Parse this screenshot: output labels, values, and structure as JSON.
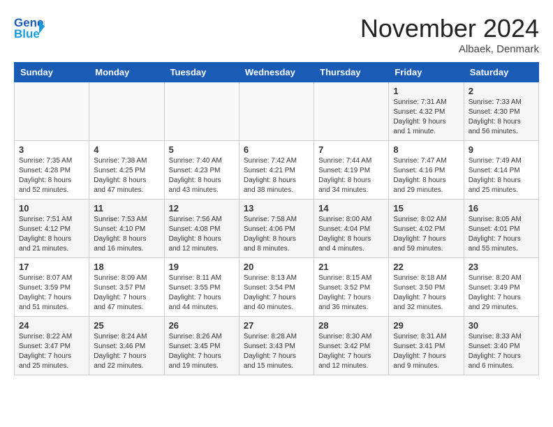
{
  "header": {
    "logo_general": "General",
    "logo_blue": "Blue",
    "month_title": "November 2024",
    "subtitle": "Albaek, Denmark"
  },
  "weekdays": [
    "Sunday",
    "Monday",
    "Tuesday",
    "Wednesday",
    "Thursday",
    "Friday",
    "Saturday"
  ],
  "weeks": [
    [
      {
        "day": "",
        "info": ""
      },
      {
        "day": "",
        "info": ""
      },
      {
        "day": "",
        "info": ""
      },
      {
        "day": "",
        "info": ""
      },
      {
        "day": "",
        "info": ""
      },
      {
        "day": "1",
        "info": "Sunrise: 7:31 AM\nSunset: 4:32 PM\nDaylight: 9 hours\nand 1 minute."
      },
      {
        "day": "2",
        "info": "Sunrise: 7:33 AM\nSunset: 4:30 PM\nDaylight: 8 hours\nand 56 minutes."
      }
    ],
    [
      {
        "day": "3",
        "info": "Sunrise: 7:35 AM\nSunset: 4:28 PM\nDaylight: 8 hours\nand 52 minutes."
      },
      {
        "day": "4",
        "info": "Sunrise: 7:38 AM\nSunset: 4:25 PM\nDaylight: 8 hours\nand 47 minutes."
      },
      {
        "day": "5",
        "info": "Sunrise: 7:40 AM\nSunset: 4:23 PM\nDaylight: 8 hours\nand 43 minutes."
      },
      {
        "day": "6",
        "info": "Sunrise: 7:42 AM\nSunset: 4:21 PM\nDaylight: 8 hours\nand 38 minutes."
      },
      {
        "day": "7",
        "info": "Sunrise: 7:44 AM\nSunset: 4:19 PM\nDaylight: 8 hours\nand 34 minutes."
      },
      {
        "day": "8",
        "info": "Sunrise: 7:47 AM\nSunset: 4:16 PM\nDaylight: 8 hours\nand 29 minutes."
      },
      {
        "day": "9",
        "info": "Sunrise: 7:49 AM\nSunset: 4:14 PM\nDaylight: 8 hours\nand 25 minutes."
      }
    ],
    [
      {
        "day": "10",
        "info": "Sunrise: 7:51 AM\nSunset: 4:12 PM\nDaylight: 8 hours\nand 21 minutes."
      },
      {
        "day": "11",
        "info": "Sunrise: 7:53 AM\nSunset: 4:10 PM\nDaylight: 8 hours\nand 16 minutes."
      },
      {
        "day": "12",
        "info": "Sunrise: 7:56 AM\nSunset: 4:08 PM\nDaylight: 8 hours\nand 12 minutes."
      },
      {
        "day": "13",
        "info": "Sunrise: 7:58 AM\nSunset: 4:06 PM\nDaylight: 8 hours\nand 8 minutes."
      },
      {
        "day": "14",
        "info": "Sunrise: 8:00 AM\nSunset: 4:04 PM\nDaylight: 8 hours\nand 4 minutes."
      },
      {
        "day": "15",
        "info": "Sunrise: 8:02 AM\nSunset: 4:02 PM\nDaylight: 7 hours\nand 59 minutes."
      },
      {
        "day": "16",
        "info": "Sunrise: 8:05 AM\nSunset: 4:01 PM\nDaylight: 7 hours\nand 55 minutes."
      }
    ],
    [
      {
        "day": "17",
        "info": "Sunrise: 8:07 AM\nSunset: 3:59 PM\nDaylight: 7 hours\nand 51 minutes."
      },
      {
        "day": "18",
        "info": "Sunrise: 8:09 AM\nSunset: 3:57 PM\nDaylight: 7 hours\nand 47 minutes."
      },
      {
        "day": "19",
        "info": "Sunrise: 8:11 AM\nSunset: 3:55 PM\nDaylight: 7 hours\nand 44 minutes."
      },
      {
        "day": "20",
        "info": "Sunrise: 8:13 AM\nSunset: 3:54 PM\nDaylight: 7 hours\nand 40 minutes."
      },
      {
        "day": "21",
        "info": "Sunrise: 8:15 AM\nSunset: 3:52 PM\nDaylight: 7 hours\nand 36 minutes."
      },
      {
        "day": "22",
        "info": "Sunrise: 8:18 AM\nSunset: 3:50 PM\nDaylight: 7 hours\nand 32 minutes."
      },
      {
        "day": "23",
        "info": "Sunrise: 8:20 AM\nSunset: 3:49 PM\nDaylight: 7 hours\nand 29 minutes."
      }
    ],
    [
      {
        "day": "24",
        "info": "Sunrise: 8:22 AM\nSunset: 3:47 PM\nDaylight: 7 hours\nand 25 minutes."
      },
      {
        "day": "25",
        "info": "Sunrise: 8:24 AM\nSunset: 3:46 PM\nDaylight: 7 hours\nand 22 minutes."
      },
      {
        "day": "26",
        "info": "Sunrise: 8:26 AM\nSunset: 3:45 PM\nDaylight: 7 hours\nand 19 minutes."
      },
      {
        "day": "27",
        "info": "Sunrise: 8:28 AM\nSunset: 3:43 PM\nDaylight: 7 hours\nand 15 minutes."
      },
      {
        "day": "28",
        "info": "Sunrise: 8:30 AM\nSunset: 3:42 PM\nDaylight: 7 hours\nand 12 minutes."
      },
      {
        "day": "29",
        "info": "Sunrise: 8:31 AM\nSunset: 3:41 PM\nDaylight: 7 hours\nand 9 minutes."
      },
      {
        "day": "30",
        "info": "Sunrise: 8:33 AM\nSunset: 3:40 PM\nDaylight: 7 hours\nand 6 minutes."
      }
    ]
  ]
}
